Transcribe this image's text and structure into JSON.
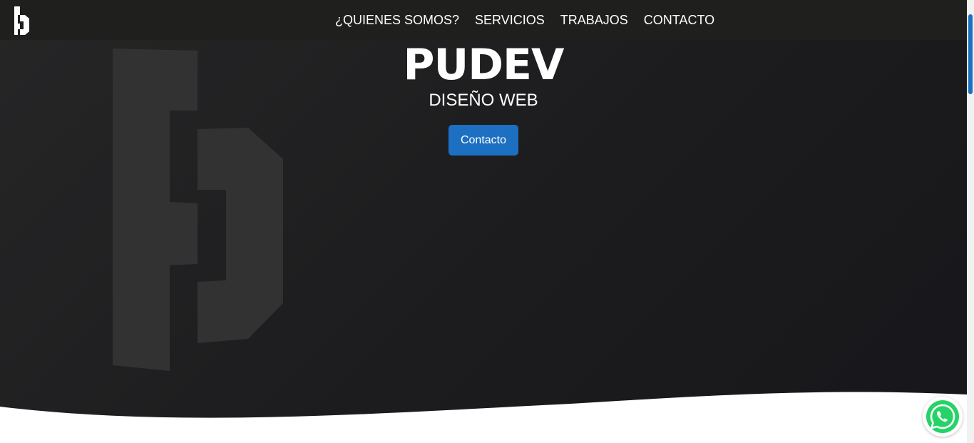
{
  "nav": {
    "logo_icon": "pudev-logo-icon",
    "links": [
      {
        "label": "¿QUIENES SOMOS?"
      },
      {
        "label": "SERVICIOS"
      },
      {
        "label": "TRABAJOS"
      },
      {
        "label": "CONTACTO"
      }
    ]
  },
  "hero": {
    "title": "PUDEV",
    "subtitle": "DISEÑO WEB",
    "cta_label": "Contacto",
    "background_icon": "pudev-logo-watermark"
  },
  "floating": {
    "whatsapp_icon": "whatsapp-icon"
  },
  "colors": {
    "nav_bg": "#1f1f1e",
    "hero_bg": "#1f1f21",
    "accent": "#1c6fc1",
    "whatsapp": "#25d366",
    "text": "#ffffff"
  }
}
